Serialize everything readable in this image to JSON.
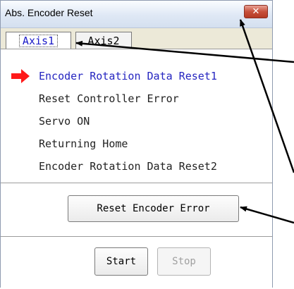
{
  "window": {
    "title": "Abs. Encoder Reset",
    "close_symbol": "✕"
  },
  "tabs": [
    {
      "label": "Axis1",
      "active": true
    },
    {
      "label": "Axis2",
      "active": false
    }
  ],
  "steps": [
    {
      "label": "Encoder Rotation Data Reset1",
      "current": true
    },
    {
      "label": "Reset Controller Error",
      "current": false
    },
    {
      "label": "Servo ON",
      "current": false
    },
    {
      "label": "Returning Home",
      "current": false
    },
    {
      "label": "Encoder Rotation Data Reset2",
      "current": false
    }
  ],
  "current_step_marker": {
    "icon": "right-arrow-icon",
    "color": "#ff1a1a"
  },
  "buttons": {
    "reset_encoder_error": "Reset Encoder Error",
    "start": "Start",
    "stop": "Stop",
    "stop_enabled": false
  },
  "annotation_arrows": {
    "color": "#000000",
    "count": 3
  },
  "colors": {
    "accent": "#1a1ac8",
    "marker": "#ff1a1a"
  }
}
